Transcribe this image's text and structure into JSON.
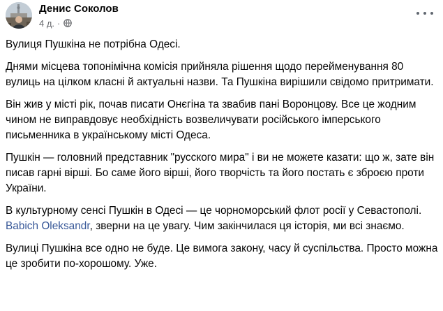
{
  "header": {
    "author_name": "Денис Соколов",
    "timestamp": "4 д.",
    "separator": "·",
    "privacy_icon": "globe-icon",
    "menu_icon": "more-options-icon"
  },
  "post": {
    "paragraphs": {
      "p1": "Вулиця Пушкіна не потрібна Одесі.",
      "p2": "Днями місцева топонімічна комісія прийняла рішення щодо перейменування 80 вулиць на цілком класні й актуальні назви. Та Пушкіна вирішили свідомо притримати.",
      "p3": "Він жив у місті рік, почав писати Онєгіна та звабив пані Воронцову. Все це жодним чином не виправдовує необхідність возвеличувати російського імперського письменника в українському місті Одеса.",
      "p4": "Пушкін — головний представник \"русского мира\" і ви не можете казати: що ж, зате він писав гарні вірші. Бо саме його вірші, його творчість та його постать є зброєю проти України.",
      "p5_before": "В культурному сенсі Пушкін в Одесі — це чорноморський флот росії у Севастополі. ",
      "p5_mention": "Babich Oleksandr",
      "p5_after": ", зверни на це увагу. Чим закінчилася ця історія, ми всі знаємо.",
      "p6": "Вулиці Пушкіна все одно не буде. Це вимога закону, часу й суспільства. Просто можна це зробити по-хорошому. Уже."
    }
  },
  "colors": {
    "text": "#050505",
    "secondary_text": "#65676b",
    "mention_link": "#385898",
    "background": "#ffffff"
  }
}
